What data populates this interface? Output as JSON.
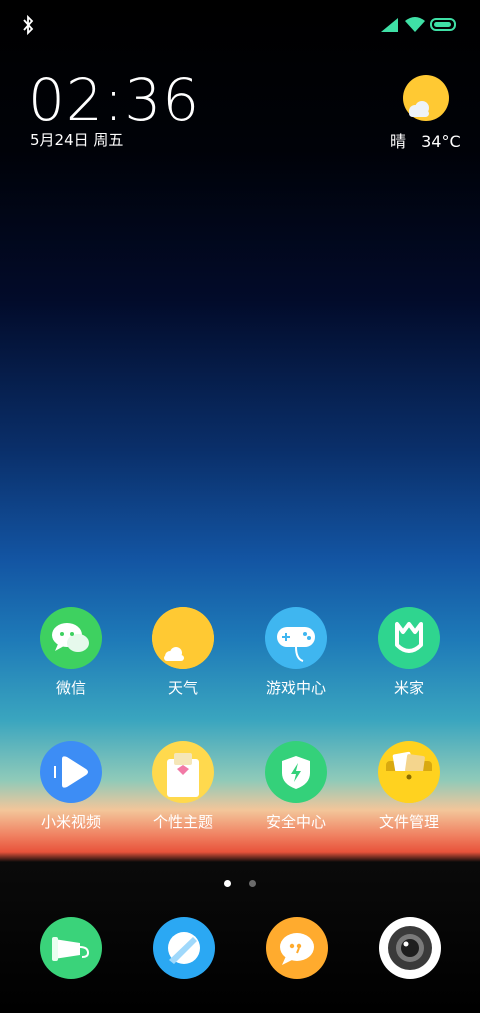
{
  "status_bar": {
    "bluetooth_icon": "bluetooth-icon",
    "signal_icon": "cellular-signal-icon",
    "wifi_icon": "wifi-icon",
    "battery_icon": "battery-icon",
    "battery_level": 0.95,
    "accent_color": "#3fe0a6"
  },
  "lockscreen_widget": {
    "time": "02:36",
    "date": "5月24日 周五",
    "weather_condition": "晴",
    "temperature": "34°C",
    "weather_icon": "sunny-cloud-icon"
  },
  "apps": [
    {
      "label": "微信",
      "icon": "wechat-icon",
      "color": "#3ed160"
    },
    {
      "label": "天气",
      "icon": "weather-icon",
      "color": "#ffc933"
    },
    {
      "label": "游戏中心",
      "icon": "gamepad-icon",
      "color": "#3fb6f0"
    },
    {
      "label": "米家",
      "icon": "mijia-icon",
      "color": "#2fd58f"
    },
    {
      "label": "小米视频",
      "icon": "video-play-icon",
      "color": "#3d8df5"
    },
    {
      "label": "个性主题",
      "icon": "themes-icon",
      "color": "#ffd94d"
    },
    {
      "label": "安全中心",
      "icon": "security-shield-icon",
      "color": "#34d17a"
    },
    {
      "label": "文件管理",
      "icon": "folder-icon",
      "color": "#ffd21f"
    }
  ],
  "page_indicator": {
    "total": 2,
    "active": 1
  },
  "dock": [
    {
      "icon": "phone-call-icon",
      "color": "#3ad37a"
    },
    {
      "icon": "browser-compass-icon",
      "color": "#2ba8f3"
    },
    {
      "icon": "message-bubble-icon",
      "color": "#ffab2e"
    },
    {
      "icon": "camera-lens-icon",
      "color": "#ffffff"
    }
  ]
}
